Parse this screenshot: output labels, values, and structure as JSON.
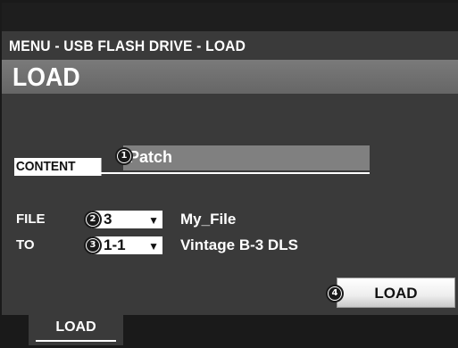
{
  "header": {
    "breadcrumb": "MENU - USB FLASH DRIVE - LOAD",
    "title": "LOAD"
  },
  "content": {
    "label": "CONTENT",
    "value": "Patch"
  },
  "badges": {
    "b1": "1",
    "b2": "2",
    "b3": "3",
    "b4": "4"
  },
  "file": {
    "label": "FILE",
    "number": "3",
    "name": "My_File"
  },
  "to": {
    "label": "TO",
    "number": "1-1",
    "name": "Vintage B-3 DLS"
  },
  "actions": {
    "load_button": "LOAD"
  },
  "tabs": [
    {
      "label": "LOAD"
    }
  ],
  "colors": {
    "screen_bg": "#3a3a3a",
    "title_bar_bg": "#707070",
    "field_bg": "#808080",
    "bottom_bar_bg": "#1a1a1a"
  }
}
